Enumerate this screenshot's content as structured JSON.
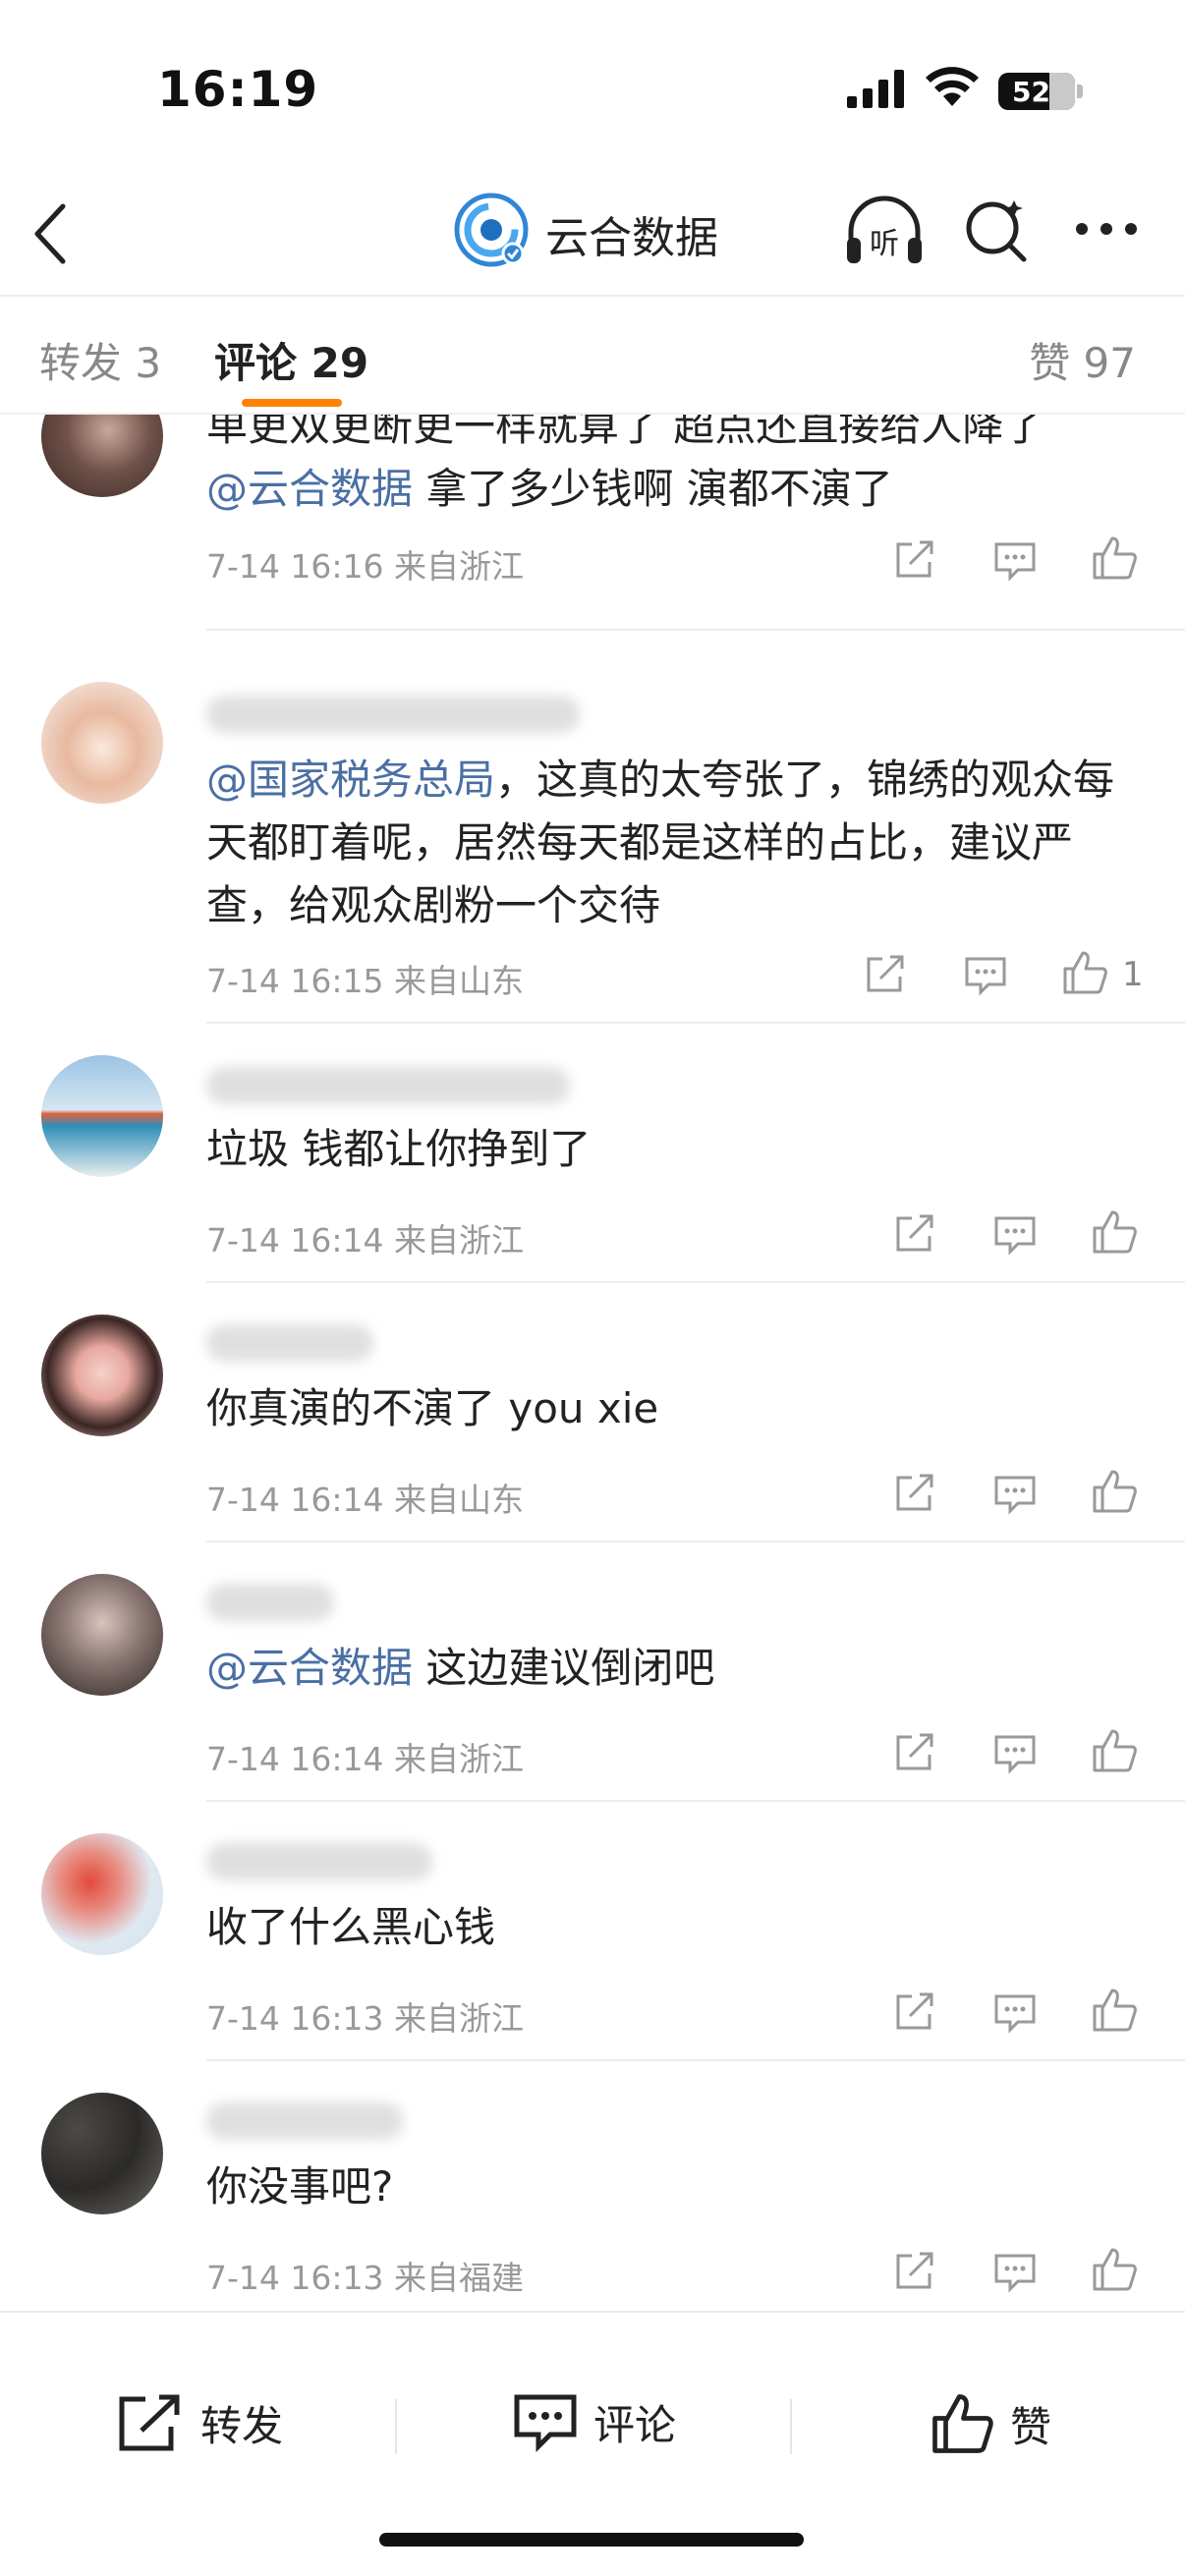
{
  "status_bar": {
    "time": "16:19",
    "battery": "52"
  },
  "nav": {
    "title": "云合数据"
  },
  "tabs": {
    "repost_label": "转发 3",
    "comment_label": "评论 29",
    "likes_label": "赞 97"
  },
  "comments": [
    {
      "mention": "",
      "text_before": "单更双更断更一样就算了 超点还直接给人降了",
      "mention2": "@云合数据",
      "text_after": " 拿了多少钱啊 演都不演了",
      "meta": "7-14 16:16 来自浙江",
      "like_count": ""
    },
    {
      "mention": "@国家税务总局",
      "text_after": "，这真的太夸张了，锦绣的观众每天都盯着呢，居然每天都是这样的占比，建议严查，给观众剧粉一个交待",
      "meta": "7-14 16:15 来自山东",
      "like_count": "1"
    },
    {
      "text": "垃圾 钱都让你挣到了",
      "meta": "7-14 16:14 来自浙江",
      "like_count": ""
    },
    {
      "text": "你真演的不演了  you xie",
      "meta": "7-14 16:14 来自山东",
      "like_count": ""
    },
    {
      "mention": "@云合数据",
      "text_after": " 这边建议倒闭吧",
      "meta": "7-14 16:14 来自浙江",
      "like_count": ""
    },
    {
      "text": "收了什么黑心钱",
      "meta": "7-14 16:13 来自浙江",
      "like_count": ""
    },
    {
      "text": "你没事吧?",
      "meta": "7-14 16:13 来自福建",
      "like_count": ""
    }
  ],
  "bottom_bar": {
    "repost": "转发",
    "comment": "评论",
    "like": "赞"
  },
  "colors": {
    "accent": "#ff8200",
    "mention": "#4a6fa5",
    "meta": "#999999"
  }
}
